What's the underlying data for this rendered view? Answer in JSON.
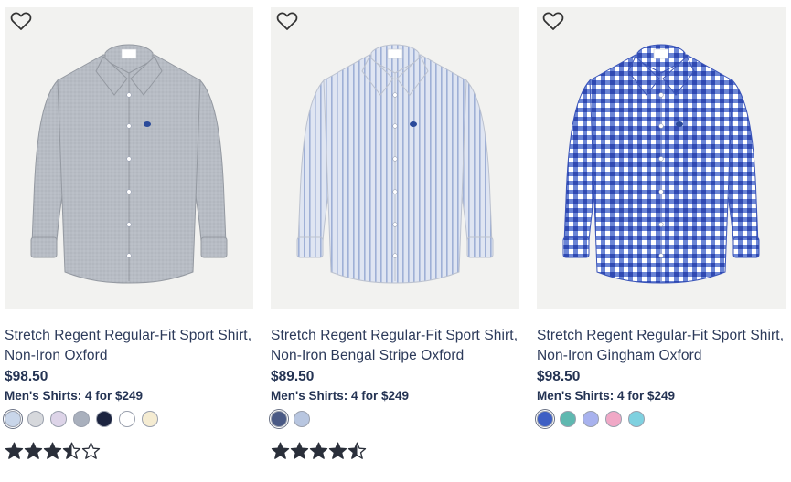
{
  "products": [
    {
      "name_line1": "Stretch Regent Regular-Fit Sport Shirt,",
      "name_line2": "Non-Iron Oxford",
      "price": "$98.50",
      "promo": "Men's Shirts: 4 for $249",
      "shirt_color": "#b7bcc4",
      "shirt_pattern": "oxford",
      "swatches": [
        "#c9d6ea",
        "#d6d8dc",
        "#ddd4e8",
        "#a9b0bd",
        "#1c2440",
        "#ffffff",
        "#f5ecd2"
      ],
      "rating": 3.5,
      "rating_max": 5
    },
    {
      "name_line1": "Stretch Regent Regular-Fit Sport Shirt,",
      "name_line2": "Non-Iron Bengal Stripe Oxford",
      "price": "$89.50",
      "promo": "Men's Shirts: 4 for $249",
      "shirt_color": "#dfe5f2",
      "shirt_pattern": "stripe",
      "swatches": [
        "#4a5a85",
        "#b8c6e0"
      ],
      "rating": 4.5,
      "rating_max": 5
    },
    {
      "name_line1": "Stretch Regent Regular-Fit Sport Shirt,",
      "name_line2": "Non-Iron Gingham Oxford",
      "price": "$98.50",
      "promo": "Men's Shirts: 4 for $249",
      "shirt_color": "#4a63c9",
      "shirt_pattern": "gingham",
      "swatches": [
        "#3e5fc4",
        "#5fb8b0",
        "#a8b2ee",
        "#f0a8c6",
        "#7fd1e0"
      ],
      "rating": null,
      "rating_max": 5
    }
  ],
  "colors": {
    "text_title": "#2c3a5a",
    "text_price": "#243353",
    "star": "#2a2f3a",
    "image_bg": "#f2f2f0"
  },
  "icons": {
    "favorite": "heart-outline-icon",
    "rating": "star-icon"
  }
}
